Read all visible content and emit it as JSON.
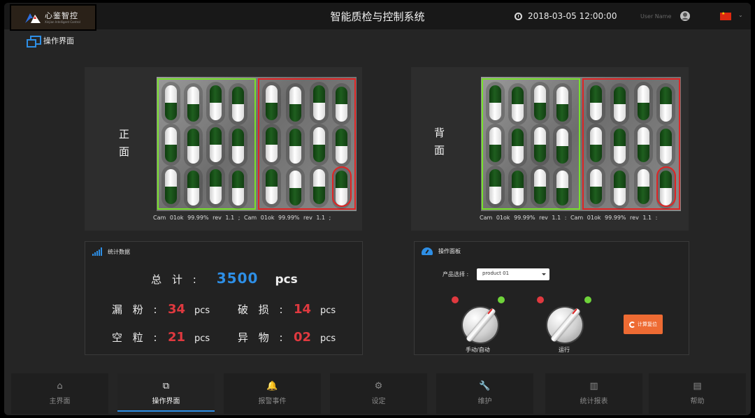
{
  "header": {
    "logo_cn": "心鉴智控",
    "logo_en": "Xinjian Intelligent Control",
    "title": "智能质检与控制系统",
    "datetime": "2018-03-05 12:00:00",
    "user_label": "User Name",
    "language_flag": "china-flag",
    "lang_arrow": "⌄"
  },
  "breadcrumb": {
    "label": "操作界面"
  },
  "cameras": {
    "front": {
      "side_label": "正面",
      "caption": "Cam 01ok 99.99%  rev 1.1 ; Cam 01ok 99.99%  rev 1.1 ;"
    },
    "back": {
      "side_label": "背面",
      "caption": "Cam 01ok 99.99%  rev 1.1 : Cam 01ok 99.99%  rev 1.1 :"
    }
  },
  "stats": {
    "title": "统计数据",
    "total_label": "总 计 :",
    "total_value": "3500",
    "total_unit": "pcs",
    "items": [
      {
        "label": "漏 粉 :",
        "value": "34",
        "unit": "pcs"
      },
      {
        "label": "破 损 :",
        "value": "14",
        "unit": "pcs"
      },
      {
        "label": "空 粒 :",
        "value": "21",
        "unit": "pcs"
      },
      {
        "label": "异 物 :",
        "value": "02",
        "unit": "pcs"
      }
    ]
  },
  "control": {
    "title": "操作面板",
    "product_label": "产品选择 :",
    "product_value": "product 01",
    "knob_manual_label": "手动/自动",
    "knob_run_label": "运行",
    "reset_label": "计算复位"
  },
  "nav": [
    {
      "label": "主界面",
      "icon": "home-icon",
      "glyph": "⌂"
    },
    {
      "label": "操作界面",
      "icon": "windows-icon",
      "glyph": "⧉"
    },
    {
      "label": "报警事件",
      "icon": "bell-icon",
      "glyph": "🔔"
    },
    {
      "label": "设定",
      "icon": "gears-icon",
      "glyph": "⚙"
    },
    {
      "label": "维护",
      "icon": "wrench-icon",
      "glyph": "🔧"
    },
    {
      "label": "统计报表",
      "icon": "bar-chart-icon",
      "glyph": "▥"
    },
    {
      "label": "帮助",
      "icon": "book-icon",
      "glyph": "▤"
    }
  ],
  "colors": {
    "accent": "#2e8fe6",
    "alert": "#e0393f",
    "ok_zone": "#78e02c",
    "ng_zone": "#e02424",
    "reset_button": "#ee6b33"
  }
}
